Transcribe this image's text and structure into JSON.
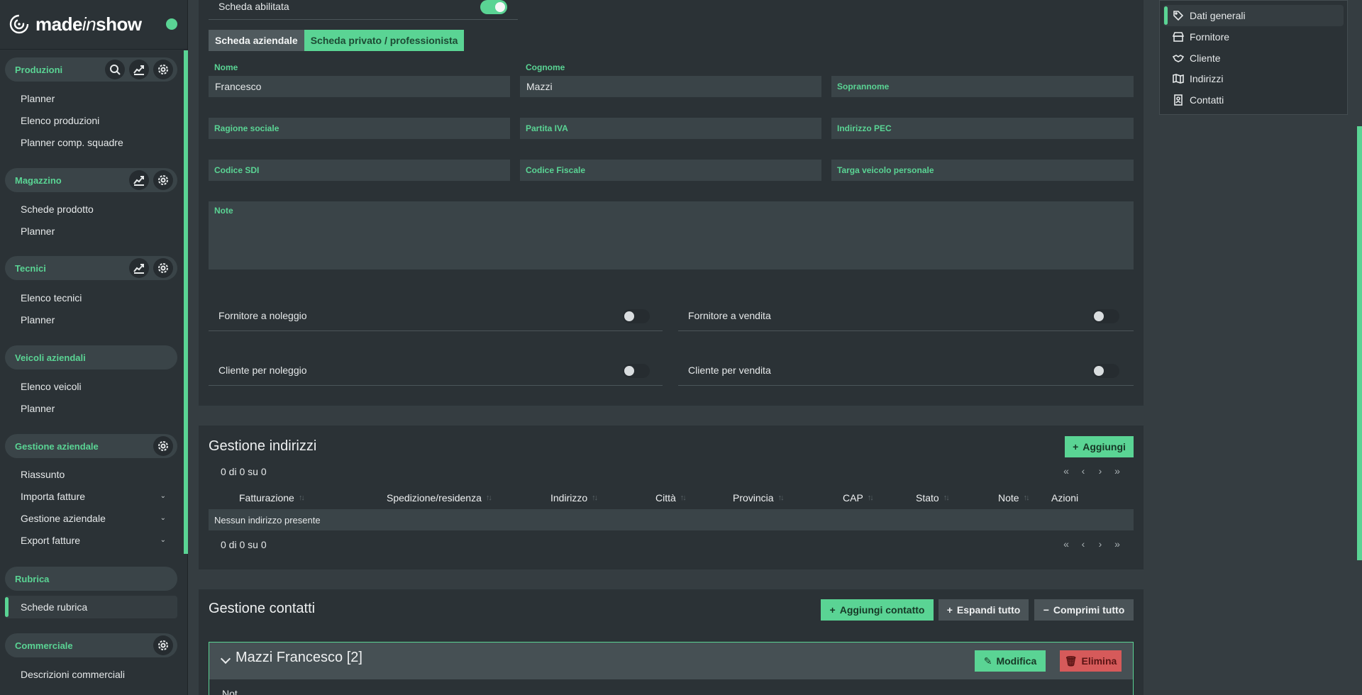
{
  "brand": {
    "name_prefix": "made",
    "name_mid": "in",
    "name_suffix": "show"
  },
  "sidebar": {
    "sections": [
      {
        "title": "Produzioni",
        "items": [
          "Planner",
          "Elenco produzioni",
          "Planner comp. squadre"
        ]
      },
      {
        "title": "Magazzino",
        "items": [
          "Schede prodotto",
          "Planner"
        ]
      },
      {
        "title": "Tecnici",
        "items": [
          "Elenco tecnici",
          "Planner"
        ]
      },
      {
        "title": "Veicoli aziendali",
        "items": [
          "Elenco veicoli",
          "Planner"
        ]
      },
      {
        "title": "Gestione aziendale",
        "items": [
          "Riassunto",
          "Importa fatture",
          "Gestione aziendale",
          "Export fatture"
        ]
      },
      {
        "title": "Rubrica",
        "items": [
          "Schede rubrica"
        ]
      },
      {
        "title": "Commerciale",
        "items": [
          "Descrizioni commerciali"
        ]
      }
    ]
  },
  "form": {
    "enabled_label": "Scheda abilitata",
    "tabs": [
      "Scheda aziendale",
      "Scheda privato / professionista"
    ],
    "nome_label": "Nome",
    "nome_value": "Francesco",
    "cognome_label": "Cognome",
    "cognome_value": "Mazzi",
    "soprannome_ph": "Soprannome",
    "ragione_ph": "Ragione sociale",
    "piva_ph": "Partita IVA",
    "pec_ph": "Indirizzo PEC",
    "sdi_ph": "Codice SDI",
    "cf_ph": "Codice Fiscale",
    "targa_ph": "Targa veicolo personale",
    "note_ph": "Note",
    "toggles": [
      "Fornitore a noleggio",
      "Fornitore a vendita",
      "Cliente per noleggio",
      "Cliente per vendita"
    ]
  },
  "addresses": {
    "title": "Gestione indirizzi",
    "add_label": "Aggiungi",
    "count_top": "0 di 0 su 0",
    "count_bottom": "0 di 0 su 0",
    "columns": [
      "Fatturazione",
      "Spedizione/residenza",
      "Indirizzo",
      "Città",
      "Provincia",
      "CAP",
      "Stato",
      "Note",
      "Azioni"
    ],
    "empty_text": "Nessun indirizzo presente"
  },
  "contacts": {
    "title": "Gestione contatti",
    "add_label": "Aggiungi contatto",
    "expand_label": "Espandi tutto",
    "collapse_label": "Comprimi tutto",
    "card_name": "Mazzi Francesco [2]",
    "edit_label": "Modifica",
    "delete_label": "Elimina",
    "note_partial": "Not"
  },
  "right_nav": {
    "items": [
      "Dati generali",
      "Fornitore",
      "Cliente",
      "Indirizzi",
      "Contatti"
    ]
  },
  "colors": {
    "accent": "#5ad494",
    "danger": "#d65a5a",
    "background": "#353d41",
    "card": "#2b3236"
  },
  "icons": {
    "sidebar_tools": [
      "search-icon",
      "chart-icon",
      "gear-icon"
    ],
    "right_nav": [
      "tag-icon",
      "store-icon",
      "handshake-icon",
      "map-icon",
      "contact-icon"
    ]
  }
}
